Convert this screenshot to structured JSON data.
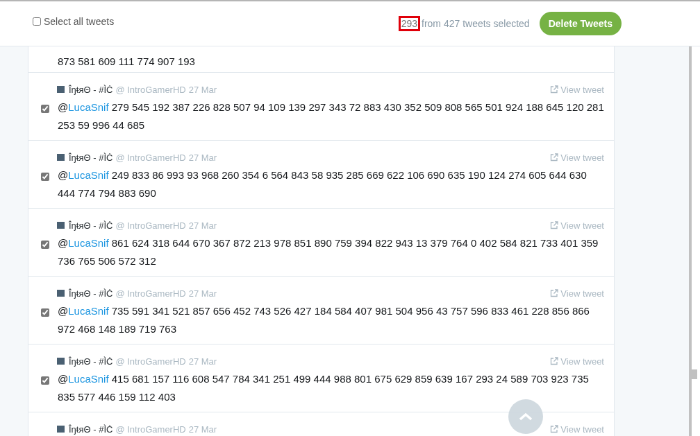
{
  "header": {
    "select_all": {
      "label": "Select all tweets",
      "checked": false
    },
    "selected_count": "293",
    "selected_text": "from 427 tweets selected",
    "delete_button": "Delete Tweets"
  },
  "tweets": [
    {
      "text": "873 581 609 111 774 907 193"
    },
    {
      "author": "ÎŋŧяΘ - #ÌĊ",
      "handle": "@ IntroGamerHD",
      "date": "27 Mar",
      "link": "View tweet",
      "checked": true,
      "mention_prefix": "@",
      "mention": "LucaSnif",
      "text": "279 545 192 387 226 828 507 94 109 139 297 343 72 883 430 352 509 808 565 501 924 188 645 120 281 253 59 996 44 685"
    },
    {
      "author": "ÎŋŧяΘ - #ÌĊ",
      "handle": "@ IntroGamerHD",
      "date": "27 Mar",
      "link": "View tweet",
      "checked": true,
      "mention_prefix": "@",
      "mention": "LucaSnif",
      "text": "249 833 86 993 93 968 260 354 6 564 843 58 935 285 669 622 106 690 635 190 124 274 605 644 630 444 774 794 883 690"
    },
    {
      "author": "ÎŋŧяΘ - #ÌĊ",
      "handle": "@ IntroGamerHD",
      "date": "27 Mar",
      "link": "View tweet",
      "checked": true,
      "mention_prefix": "@",
      "mention": "LucaSnif",
      "text": "861 624 318 644 670 367 872 213 978 851 890 759 394 822 943 13 379 764 0 402 584 821 733 401 359 736 765 506 572 312"
    },
    {
      "author": "ÎŋŧяΘ - #ÌĊ",
      "handle": "@ IntroGamerHD",
      "date": "27 Mar",
      "link": "View tweet",
      "checked": true,
      "mention_prefix": "@",
      "mention": "LucaSnif",
      "text": "735 591 341 521 857 656 452 743 526 427 184 584 407 981 504 956 43 757 596 833 461 228 856 866 972 468 148 189 719 763"
    },
    {
      "author": "ÎŋŧяΘ - #ÌĊ",
      "handle": "@ IntroGamerHD",
      "date": "27 Mar",
      "link": "View tweet",
      "checked": true,
      "mention_prefix": "@",
      "mention": "LucaSnif",
      "text": "415 681 157 116 608 547 784 341 251 499 444 988 801 675 629 859 639 167 293 24 589 703 923 735 835 577 446 159 112 403"
    },
    {
      "author": "ÎŋŧяΘ - #ÌĊ",
      "handle": "@ IntroGamerHD",
      "date": "27 Mar",
      "link": "View tweet"
    }
  ]
}
